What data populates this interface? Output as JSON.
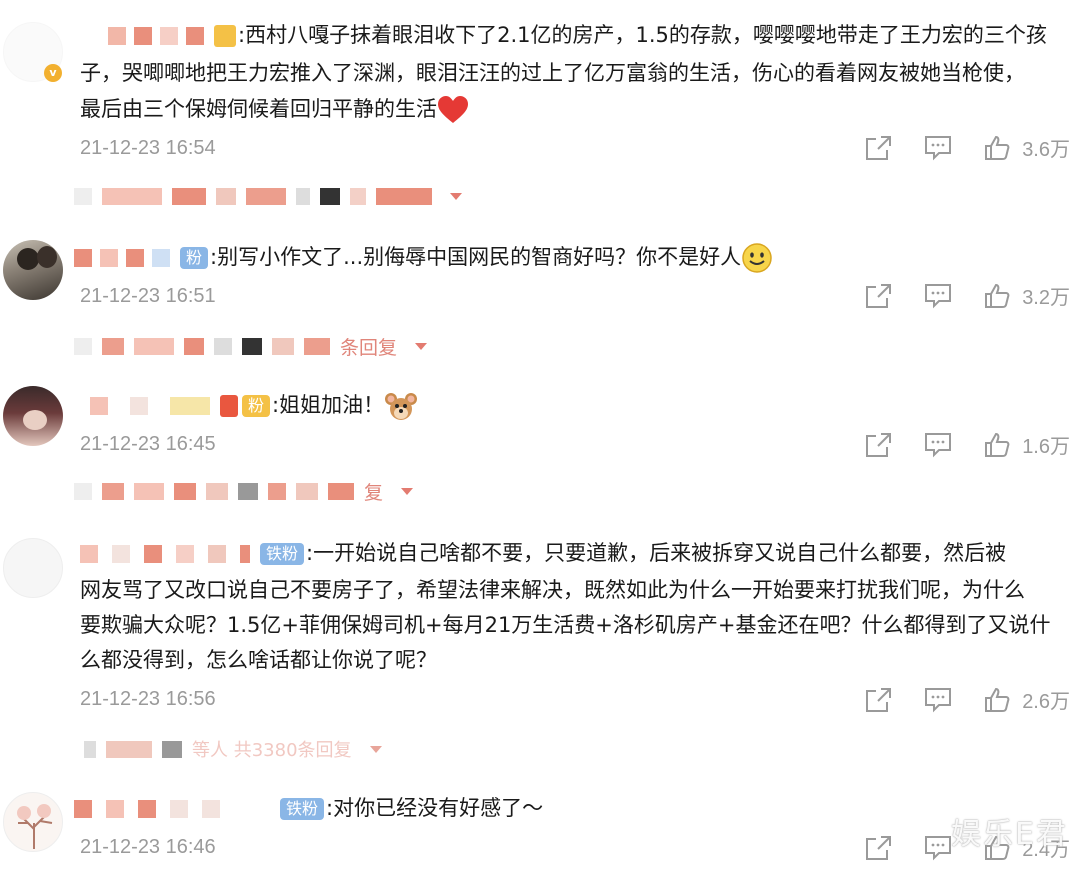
{
  "comments": [
    {
      "lines": [
        "西村八嘎子抹着眼泪收下了2.1亿的房产，1.5的存款，嘤嘤嘤地带走了王力宏的三个孩",
        "子，哭唧唧地把王力宏推入了深渊，眼泪汪汪的过上了亿万富翁的生活，伤心的看着网友被她当枪使，",
        "最后由三个保姆伺候着回归平静的生活"
      ],
      "time": "21-12-23 16:54",
      "likes": "3.6万"
    },
    {
      "badge": "粉",
      "lines": [
        "别写小作文了...别侮辱中国网民的智商好吗？你不是好人"
      ],
      "time": "21-12-23 16:51",
      "likes": "3.2万",
      "replies_text": "条回复"
    },
    {
      "badge": "粉",
      "lines": [
        "姐姐加油！"
      ],
      "time": "21-12-23 16:45",
      "likes": "1.6万",
      "replies_text": "复"
    },
    {
      "badge": "铁粉",
      "lines": [
        "一开始说自己啥都不要，只要道歉，后来被拆穿又说自己什么都要，然后被",
        "网友骂了又改口说自己不要房子了，希望法律来解决，既然如此为什么一开始要来打扰我们呢，为什么",
        "要欺骗大众呢？1.5亿+菲佣保姆司机+每月21万生活费+洛杉矶房产+基金还在吧？什么都得到了又说什",
        "么都没得到，怎么啥话都让你说了呢？"
      ],
      "time": "21-12-23 16:56",
      "likes": "2.6万",
      "replies_text": "等人 共3380条回复"
    },
    {
      "badge": "铁粉",
      "lines": [
        "对你已经没有好感了～"
      ],
      "time": "21-12-23 16:46",
      "likes": "2.4万"
    }
  ],
  "watermark": "娱乐E君",
  "colors": {
    "mosaic": "#e98f7c",
    "fan_badge": "#8ab6e6",
    "reply_link": "#e37b70",
    "meta_gray": "#9a9a9a"
  }
}
